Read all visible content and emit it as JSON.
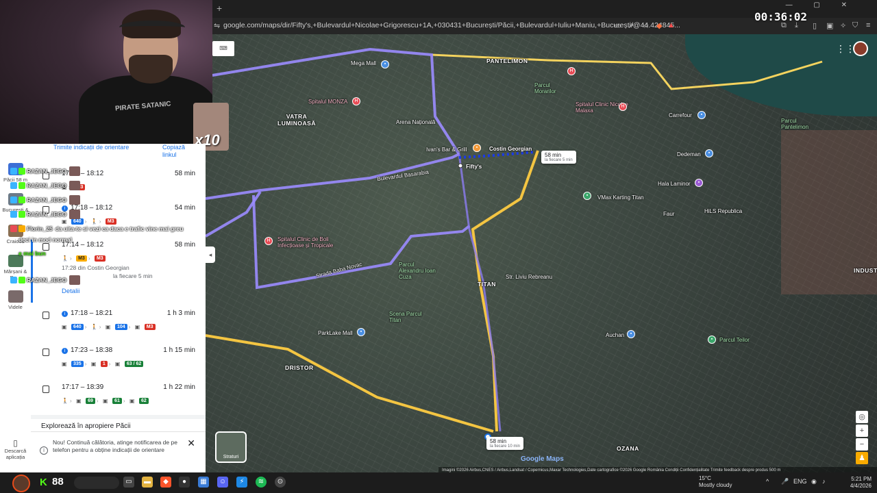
{
  "browser": {
    "url": "google.com/maps/dir/Fifty's,+Bulevardul+Nicolae+Grigorescu+1A,+030431+București/Păcii,+Bulevardul+Iuliu+Maniu,+București/@44.424845...",
    "timer": "00:36:02"
  },
  "webcam": {
    "shirt_text": "PIRATE SATANIC",
    "multiplier": "x10"
  },
  "sidebar": {
    "items": [
      {
        "label": "Păcii 58 m"
      },
      {
        "label": "București &"
      },
      {
        "label": "Craiova"
      },
      {
        "label": "Mărșani & Da..."
      },
      {
        "label": "Videle"
      }
    ],
    "download_label": "Descarcă aplicația"
  },
  "panel": {
    "send_label": "Trimite indicații de orientare",
    "copy_label": "Copiază linkul",
    "routes": [
      {
        "time": "17:14 – 18:12",
        "duration": "58 min",
        "chips": [
          {
            "t": "M3",
            "c": "red"
          }
        ]
      },
      {
        "time": "17:18 – 18:12",
        "duration": "54 min",
        "chips": [
          {
            "t": "640",
            "c": "blue"
          },
          {
            "t": "M3",
            "c": "red"
          }
        ]
      },
      {
        "time": "17:14 – 18:12",
        "duration": "58 min",
        "chips": [
          {
            "t": "M3",
            "c": "yellow"
          },
          {
            "t": "M3",
            "c": "red"
          }
        ],
        "sub": "17:28 din Costin Georgian",
        "sub2": "la fiecare 5 min",
        "details": "Detalii"
      },
      {
        "time": "17:18 – 18:21",
        "duration": "1 h 3 min",
        "chips": [
          {
            "t": "640",
            "c": "blue"
          },
          {
            "t": "104",
            "c": "blue"
          },
          {
            "t": "M3",
            "c": "red"
          }
        ]
      },
      {
        "time": "17:23 – 18:38",
        "duration": "1 h 15 min",
        "chips": [
          {
            "t": "335",
            "c": "blue"
          },
          {
            "t": "1",
            "c": "red"
          },
          {
            "t": "63 / 62",
            "c": "green"
          }
        ]
      },
      {
        "time": "17:17 – 18:39",
        "duration": "1 h 22 min",
        "chips": [
          {
            "t": "69",
            "c": "green"
          },
          {
            "t": "61",
            "c": "green"
          },
          {
            "t": "62",
            "c": "green"
          }
        ]
      }
    ],
    "explore": "Explorează în apropiere Păcii",
    "notice": "Nou! Continuă călătoria, atinge notificarea de pe telefon pentru a obține indicații de orientare"
  },
  "chat": [
    {
      "name": "RAZAN_JEGO",
      "msg": ""
    },
    {
      "name": "RAZAN_JEGO",
      "msg": ""
    },
    {
      "name": "RAZAN_JEGO",
      "msg": ""
    },
    {
      "name": "RAZAN_JEGO",
      "msg": ""
    },
    {
      "name": "Florin_25",
      "msg": "da uita-te si vezi ca daca e trafic vine mai greu"
    },
    {
      "name": "",
      "msg": "deci in mod normal"
    },
    {
      "name": "",
      "msg": "e mai bun"
    },
    {
      "name": "RAZAN_JEGO",
      "msg": ""
    }
  ],
  "map": {
    "places": [
      {
        "t": "PANTELIMON",
        "k": "big"
      },
      {
        "t": "VATRA LUMINOASĂ",
        "k": "big"
      },
      {
        "t": "Mega Mall",
        "k": ""
      },
      {
        "t": "Arena Națională",
        "k": ""
      },
      {
        "t": "Spitalul MONZA",
        "k": "pink"
      },
      {
        "t": "Parcul Morarilor",
        "k": "green"
      },
      {
        "t": "Spitalul Clinic Nicolae Malaxa",
        "k": "pink"
      },
      {
        "t": "Carrefour",
        "k": ""
      },
      {
        "t": "Parcul Pantelimon",
        "k": "green"
      },
      {
        "t": "Dedeman",
        "k": ""
      },
      {
        "t": "Hala Laminor",
        "k": ""
      },
      {
        "t": "VMax Karting Titan",
        "k": ""
      },
      {
        "t": "Faur",
        "k": ""
      },
      {
        "t": "HiLS Republica",
        "k": ""
      },
      {
        "t": "Costin Georgian",
        "k": ""
      },
      {
        "t": "Ivan's Bar & Grill",
        "k": ""
      },
      {
        "t": "Fifty's",
        "k": ""
      },
      {
        "t": "Spitalul Clinic de Boli Infecțioase și Tropicale",
        "k": "pink"
      },
      {
        "t": "Parcul Alexandru Ioan Cuza",
        "k": "green"
      },
      {
        "t": "TITAN",
        "k": "big"
      },
      {
        "t": "Scena Parcul Titan",
        "k": "green"
      },
      {
        "t": "ParkLake Mall",
        "k": ""
      },
      {
        "t": "Auchan",
        "k": ""
      },
      {
        "t": "Parcul Teilor",
        "k": "green"
      },
      {
        "t": "DRISTOR",
        "k": "big"
      },
      {
        "t": "OZANA",
        "k": "big"
      },
      {
        "t": "INDUSTRI",
        "k": "big"
      },
      {
        "t": "Bulevardul Basarabia",
        "k": ""
      },
      {
        "t": "Strada Baba Novac",
        "k": ""
      },
      {
        "t": "Str. Liviu Rebreanu",
        "k": ""
      }
    ],
    "callout1": {
      "title": "58 min",
      "sub": "la fiecare 5 min"
    },
    "callout2": {
      "title": "58 min",
      "sub": "la fiecare 10 min"
    },
    "layers": "Straturi",
    "footer": "Imagini ©2026 Airbus,CNES / Airbus,Landsat / Copernicus,Maxar Technologies,Date cartografice ©2026 Google   România   Condiții   Confidențialitate   Trimite feedback despre produs   500 m",
    "google": "Google Maps"
  },
  "taskbar": {
    "viewers": "88",
    "kick_logo": "K",
    "weather_temp": "15°C",
    "weather_desc": "Mostly cloudy",
    "lang": "ENG",
    "time": "5:21 PM",
    "date": "4/4/2026"
  }
}
